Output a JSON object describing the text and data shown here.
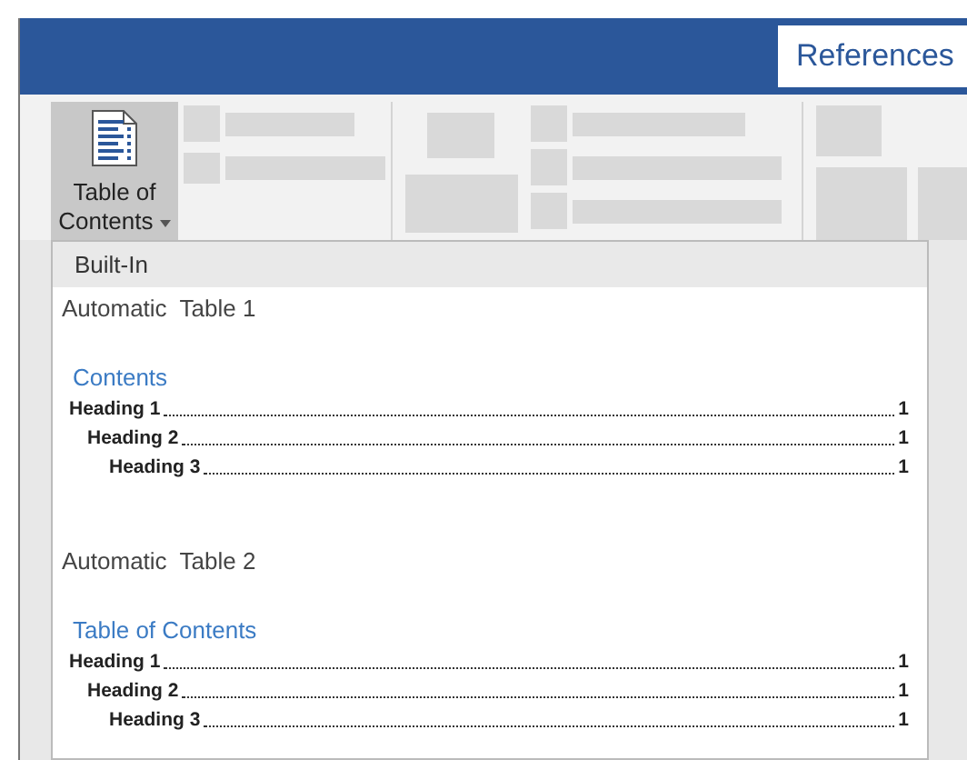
{
  "ribbon_tab": {
    "label": "References",
    "selected": true
  },
  "toc_button": {
    "label": "Table of Contents"
  },
  "dropdown": {
    "section": "Built-In",
    "templates": [
      {
        "name": "Automatic  Table 1",
        "heading": "Contents",
        "entries": [
          {
            "text": "Heading 1",
            "page": "1",
            "children": [
              {
                "text": "Heading 2",
                "page": "1",
                "children": [
                  {
                    "text": "Heading 3",
                    "page": "1"
                  }
                ]
              }
            ]
          }
        ]
      },
      {
        "name": "Automatic  Table 2",
        "heading": "Table of Contents",
        "entries": [
          {
            "text": "Heading 1",
            "page": "1",
            "children": [
              {
                "text": "Heading 2",
                "page": "1",
                "children": [
                  {
                    "text": "Heading 3",
                    "page": "1"
                  }
                ]
              }
            ]
          }
        ]
      }
    ]
  }
}
